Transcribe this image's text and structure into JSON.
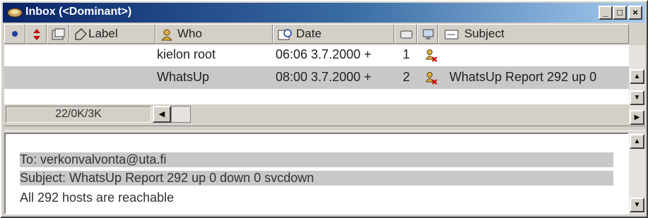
{
  "window": {
    "title": "Inbox (<Dominant>)",
    "controls": {
      "minimize": "_",
      "maximize": "□",
      "close": "×"
    }
  },
  "columns": {
    "attachment_icon": "dot-icon",
    "priority_icon": "priority-arrows-icon",
    "mailbox_icon": "mailbox-icon",
    "label": "Label",
    "who": "Who",
    "date": "Date",
    "size_icon": "size-icon",
    "server_icon": "server-icon",
    "subject": "Subject"
  },
  "messages": [
    {
      "who": "kielon root",
      "date": "06:06 3.7.2000 +",
      "size": "1",
      "status_icon": "deleted-person-icon",
      "subject": ""
    },
    {
      "who": "WhatsUp",
      "date": "08:00 3.7.2000 +",
      "size": "2",
      "status_icon": "deleted-person-icon",
      "subject": "WhatsUp Report 292 up 0"
    }
  ],
  "status": {
    "count": "22/0K/3K"
  },
  "preview": {
    "to": "To: verkonvalvonta@uta.fi",
    "subject": "Subject: WhatsUp Report 292 up 0 down 0 svcdown",
    "body": "All 292 hosts are reachable"
  },
  "colors": {
    "titlebar_start": "#0a246a",
    "titlebar_end": "#a6caf0",
    "selected_row": "#c8c8c8"
  }
}
